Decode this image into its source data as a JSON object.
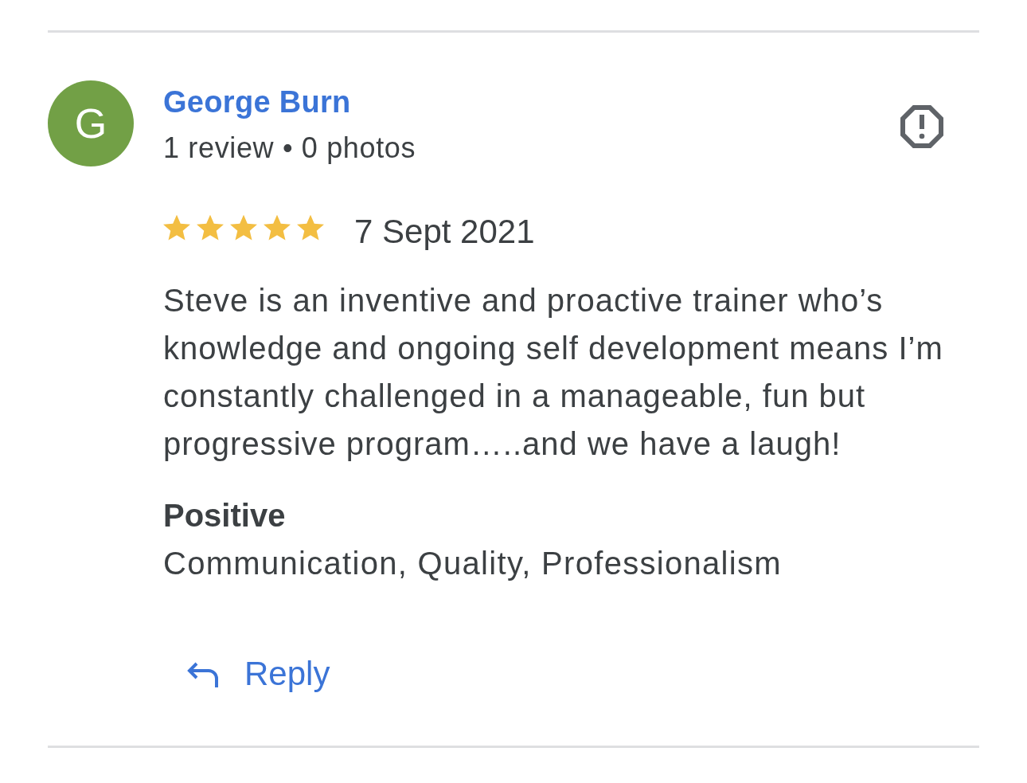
{
  "review": {
    "reviewer": {
      "avatar_letter": "G",
      "name": "George Burn",
      "meta": "1 review • 0 photos"
    },
    "stars": 5,
    "date": "7 Sept 2021",
    "text": "Steve is an inventive and proactive trainer who’s knowledge and ongoing self development means I’m constantly challenged in a manageable, fun but progressive program…..and we have a laugh!",
    "highlights": {
      "label": "Positive",
      "items": "Communication, Quality, Professionalism"
    },
    "reply_button": {
      "label": "Reply"
    }
  }
}
